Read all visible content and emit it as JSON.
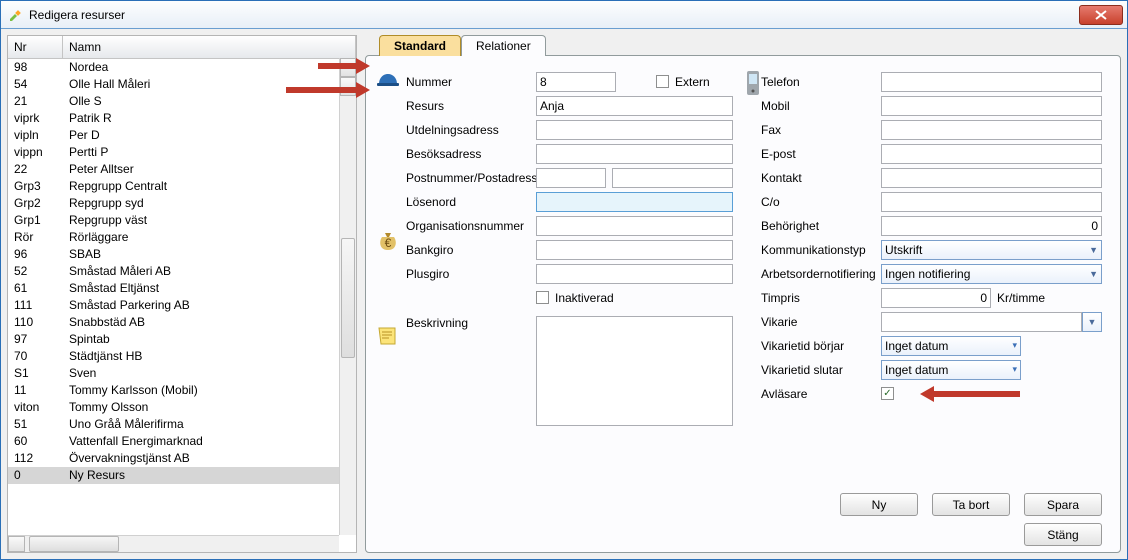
{
  "window": {
    "title": "Redigera resurser"
  },
  "list": {
    "headers": {
      "nr": "Nr",
      "name": "Namn"
    },
    "rows": [
      {
        "nr": "98",
        "name": "Nordea"
      },
      {
        "nr": "54",
        "name": "Olle Hall  Måleri"
      },
      {
        "nr": "21",
        "name": "Olle S"
      },
      {
        "nr": "viprk",
        "name": "Patrik R"
      },
      {
        "nr": "vipln",
        "name": "Per D"
      },
      {
        "nr": "vippn",
        "name": "Pertti P"
      },
      {
        "nr": "22",
        "name": "Peter Alltser"
      },
      {
        "nr": "Grp3",
        "name": "Repgrupp Centralt"
      },
      {
        "nr": "Grp2",
        "name": "Repgrupp syd"
      },
      {
        "nr": "Grp1",
        "name": "Repgrupp väst"
      },
      {
        "nr": "Rör",
        "name": "Rörläggare"
      },
      {
        "nr": "96",
        "name": "SBAB"
      },
      {
        "nr": "52",
        "name": "Småstad  Måleri  AB"
      },
      {
        "nr": "61",
        "name": "Småstad Eltjänst"
      },
      {
        "nr": "111",
        "name": "Småstad Parkering AB"
      },
      {
        "nr": "110",
        "name": "Snabbstäd AB"
      },
      {
        "nr": "97",
        "name": "Spintab"
      },
      {
        "nr": "70",
        "name": "Städtjänst HB"
      },
      {
        "nr": "S1",
        "name": "Sven"
      },
      {
        "nr": "11",
        "name": "Tommy Karlsson (Mobil)"
      },
      {
        "nr": "viton",
        "name": "Tommy Olsson"
      },
      {
        "nr": "51",
        "name": "Uno Gråå  Målerifirma"
      },
      {
        "nr": "60",
        "name": "Vattenfall Energimarknad"
      },
      {
        "nr": "112",
        "name": "Övervakningstjänst AB"
      },
      {
        "nr": "0",
        "name": "Ny Resurs"
      }
    ]
  },
  "tabs": {
    "standard": "Standard",
    "relationer": "Relationer"
  },
  "leftFields": {
    "nummer": "Nummer",
    "nummer_val": "8",
    "extern": "Extern",
    "resurs": "Resurs",
    "resurs_val": "Anja",
    "utdel": "Utdelningsadress",
    "besok": "Besöksadress",
    "post": "Postnummer/Postadress",
    "losen": "Lösenord",
    "orgnr": "Organisationsnummer",
    "bankgiro": "Bankgiro",
    "plusgiro": "Plusgiro",
    "inakt": "Inaktiverad",
    "beskr": "Beskrivning"
  },
  "rightFields": {
    "telefon": "Telefon",
    "mobil": "Mobil",
    "fax": "Fax",
    "epost": "E-post",
    "kontakt": "Kontakt",
    "co": "C/o",
    "beh": "Behörighet",
    "beh_val": "0",
    "kommtyp": "Kommunikationstyp",
    "kommtyp_val": "Utskrift",
    "aon": "Arbetsordernotifiering",
    "aon_val": "Ingen notifiering",
    "timpris": "Timpris",
    "timpris_val": "0",
    "timpris_unit": "Kr/timme",
    "vikarie": "Vikarie",
    "vb": "Vikarietid börjar",
    "vb_val": "Inget datum",
    "vs": "Vikarietid slutar",
    "vs_val": "Inget datum",
    "avl": "Avläsare"
  },
  "buttons": {
    "ny": "Ny",
    "tabort": "Ta bort",
    "spara": "Spara",
    "stang": "Stäng"
  }
}
